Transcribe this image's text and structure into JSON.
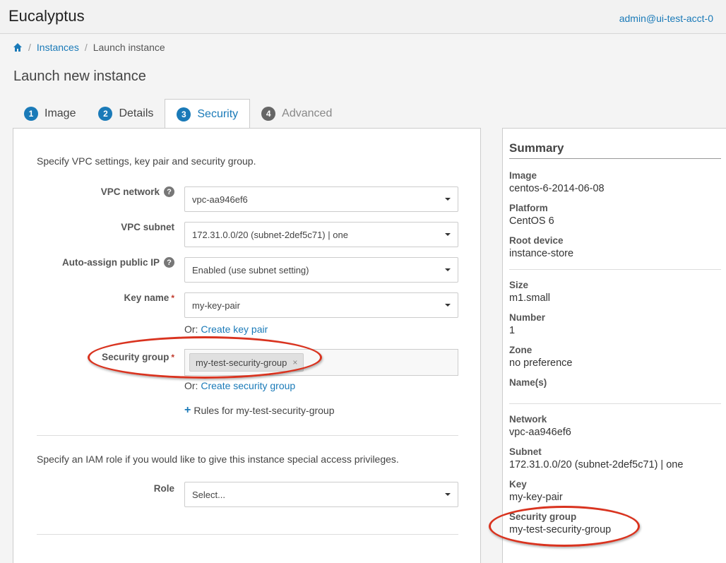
{
  "app": {
    "title": "Eucalyptus",
    "user": "admin@ui-test-acct-0"
  },
  "breadcrumb": {
    "home_icon": "home-icon",
    "items": [
      "Instances",
      "Launch instance"
    ],
    "separator": "/"
  },
  "page": {
    "title": "Launch new instance"
  },
  "tabs": [
    {
      "num": "1",
      "label": "Image"
    },
    {
      "num": "2",
      "label": "Details"
    },
    {
      "num": "3",
      "label": "Security"
    },
    {
      "num": "4",
      "label": "Advanced"
    }
  ],
  "form": {
    "intro": "Specify VPC settings, key pair and security group.",
    "vpc_network": {
      "label": "VPC network",
      "help": "?",
      "value": "vpc-aa946ef6"
    },
    "vpc_subnet": {
      "label": "VPC subnet",
      "value": "172.31.0.0/20 (subnet-2def5c71) | one"
    },
    "auto_ip": {
      "label": "Auto-assign public IP",
      "help": "?",
      "value": "Enabled (use subnet setting)"
    },
    "key_name": {
      "label": "Key name",
      "required": "*",
      "value": "my-key-pair",
      "or": "Or:",
      "create_link": "Create key pair"
    },
    "security_group": {
      "label": "Security group",
      "required": "*",
      "tag": "my-test-security-group",
      "remove": "×",
      "or": "Or:",
      "create_link": "Create security group"
    },
    "rules": {
      "plus": "+",
      "label": "Rules for my-test-security-group"
    },
    "iam_intro": "Specify an IAM role if you would like to give this instance special access privileges.",
    "role": {
      "label": "Role",
      "value": "Select..."
    }
  },
  "summary": {
    "title": "Summary",
    "items": [
      {
        "key": "Image",
        "value": "centos-6-2014-06-08"
      },
      {
        "key": "Platform",
        "value": "CentOS 6"
      },
      {
        "key": "Root device",
        "value": "instance-store"
      },
      {
        "key": "Size",
        "value": "m1.small"
      },
      {
        "key": "Number",
        "value": "1"
      },
      {
        "key": "Zone",
        "value": "no preference"
      },
      {
        "key": "Name(s)",
        "value": ""
      },
      {
        "key": "Network",
        "value": "vpc-aa946ef6"
      },
      {
        "key": "Subnet",
        "value": "172.31.0.0/20 (subnet-2def5c71) | one"
      },
      {
        "key": "Key",
        "value": "my-key-pair"
      },
      {
        "key": "Security group",
        "value": "my-test-security-group"
      }
    ]
  },
  "colors": {
    "accent": "#1a7ab8",
    "annotation": "#d9331f"
  }
}
